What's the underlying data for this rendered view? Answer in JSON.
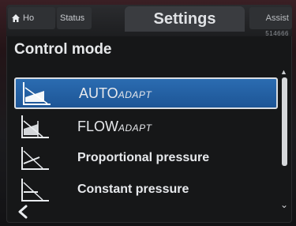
{
  "header": {
    "home_label": "Ho",
    "status_label": "Status",
    "settings_label": "Settings",
    "assist_label": "Assist",
    "code": "514666"
  },
  "page": {
    "title": "Control mode"
  },
  "items": [
    {
      "main": "AUTO",
      "suffix": "ADAPT",
      "icon": "autoadapt-curve-icon",
      "selected": true
    },
    {
      "main": "FLOW",
      "suffix": "ADAPT",
      "icon": "flowadapt-curve-icon",
      "selected": false
    },
    {
      "main": "Proportional pressure",
      "suffix": "",
      "icon": "proportional-pressure-curve-icon",
      "selected": false
    },
    {
      "main": "Constant pressure",
      "suffix": "",
      "icon": "constant-pressure-curve-icon",
      "selected": false
    }
  ],
  "colors": {
    "selected": "#2b6cb1",
    "background": "#161718"
  }
}
